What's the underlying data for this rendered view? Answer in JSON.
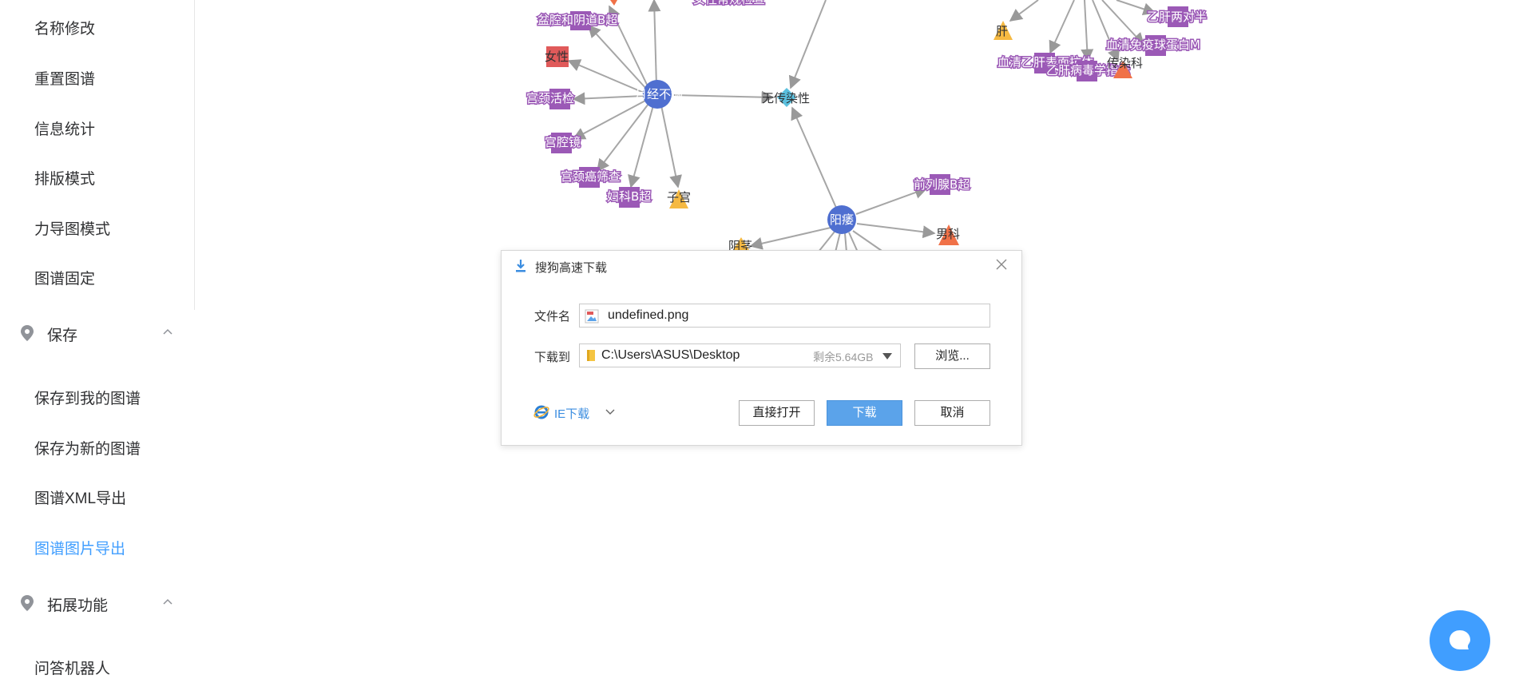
{
  "sidebar": {
    "top_items": [
      {
        "label": "名称修改"
      },
      {
        "label": "重置图谱"
      },
      {
        "label": "信息统计"
      },
      {
        "label": "排版模式"
      },
      {
        "label": "力导图模式"
      },
      {
        "label": "图谱固定"
      }
    ],
    "save_group": {
      "title": "保存",
      "icon": "location-pin-icon",
      "expanded": true,
      "items": [
        {
          "label": "保存到我的图谱"
        },
        {
          "label": "保存为新的图谱"
        },
        {
          "label": "图谱XML导出"
        },
        {
          "label": "图谱图片导出",
          "active": true
        }
      ]
    },
    "ext_group": {
      "title": "拓展功能",
      "icon": "location-pin-icon",
      "expanded": true,
      "items": [
        {
          "label": "问答机器人"
        }
      ]
    },
    "active_color": "#409eff"
  },
  "graph": {
    "colors": {
      "center": "#4f6fd0",
      "attribute": "#9b59b6",
      "category": "#f5b942",
      "warning": "#f07148",
      "gender": "#e05a5a",
      "property": "#5bc0de",
      "edge": "#999999"
    },
    "nodes": {
      "yuejing": "月经不调",
      "yangwei": "阳痿",
      "wuchuanranxing": "无传染性",
      "pengqiang": "盆腔和阴道B超",
      "nvxing": "女性",
      "gongjing_huojian": "宫颈活检",
      "gongqiangjing": "宫腔镜",
      "gongjing_aishaicha": "宫颈癌筛查",
      "fuke_bchao": "妇科B超",
      "zigong": "子宫",
      "qianliexian": "前列腺B超",
      "nanke": "男科",
      "yinjing": "阴茎",
      "gan": "肝",
      "yigan_liangduiban": "乙肝两对半",
      "xueqing_mianyiqiudanbai": "血清免疫球蛋白M",
      "xueqing_yigan": "血清乙肝表面抗体",
      "yigan_bingdu": "乙肝病毒学指标",
      "chuanranke": "传染科",
      "truncated_top": "女性常规检查"
    }
  },
  "dialog": {
    "title": "搜狗高速下载",
    "title_icon": "download-icon",
    "filename_label": "文件名",
    "filename": "undefined.png",
    "saveto_label": "下载到",
    "path": "C:\\Users\\ASUS\\Desktop",
    "free_space": "剩余5.64GB",
    "browse_label": "浏览...",
    "ie_download_label": "IE下载",
    "open_label": "直接打开",
    "download_label": "下载",
    "cancel_label": "取消",
    "primary_color": "#5ba3ea"
  },
  "chat": {
    "icon": "chat-bubble-icon",
    "color": "#409eff"
  }
}
